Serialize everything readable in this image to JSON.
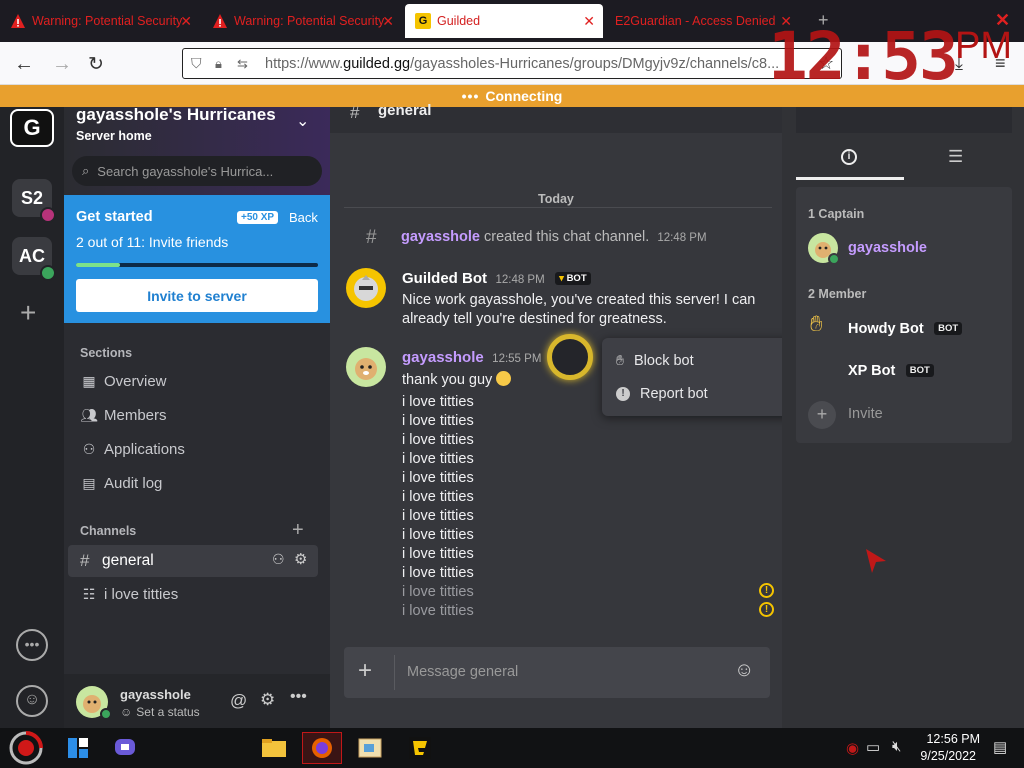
{
  "browser": {
    "tabs": [
      {
        "label": "Warning: Potential Security Risk",
        "active": false
      },
      {
        "label": "Warning: Potential Security Risk",
        "active": false
      },
      {
        "label": "Guilded",
        "active": true
      },
      {
        "label": "E2Guardian - Access Denied",
        "active": false
      }
    ],
    "url_prefix": "https://www.",
    "url_domain": "guilded.gg",
    "url_path": "/gayassholes-Hurricanes/groups/DMgyjv9z/channels/c8...",
    "overlay_time": "12:53",
    "overlay_ampm": "PM"
  },
  "connection_status": "Connecting",
  "server": {
    "name": "gayasshole's Hurricanes",
    "home_label": "Server home",
    "search_placeholder": "Search gayasshole's Hurrica...",
    "rail_icons": [
      "G",
      "S2",
      "AC"
    ]
  },
  "get_started": {
    "title": "Get started",
    "xp_badge": "+50 XP",
    "back_label": "Back",
    "progress_text": "2 out of 11: Invite friends",
    "progress_fraction": 0.18,
    "invite_button": "Invite to server"
  },
  "sections": {
    "header": "Sections",
    "items": [
      "Overview",
      "Members",
      "Applications",
      "Audit log"
    ]
  },
  "channels": {
    "header": "Channels",
    "items": [
      "general",
      "i love titties"
    ]
  },
  "user_panel": {
    "name": "gayasshole",
    "status": "Set a status"
  },
  "chat": {
    "channel_name": "general",
    "date_divider": "Today",
    "system_message": {
      "user": "gayasshole",
      "text": "created this chat channel.",
      "time": "12:48 PM"
    },
    "bot_message": {
      "author": "Guilded Bot",
      "time": "12:48 PM",
      "badge": "BOT",
      "line1": "Nice work gayasshole, you've created this server! I can",
      "line2": "already tell you're destined for greatness."
    },
    "user_message": {
      "author": "gayasshole",
      "time": "12:55 PM",
      "first_line": "thank you guy",
      "lines": [
        "i love titties",
        "i love titties",
        "i love titties",
        "i love titties",
        "i love titties",
        "i love titties",
        "i love titties",
        "i love titties",
        "i love titties",
        "i love titties",
        "i love titties",
        "i love titties"
      ]
    },
    "input_placeholder": "Message general"
  },
  "context_menu": {
    "items": [
      "Block bot",
      "Report bot"
    ]
  },
  "members": {
    "captain_header": "1 Captain",
    "captain_name": "gayasshole",
    "member_header": "2 Member",
    "members": [
      {
        "name": "Howdy Bot",
        "badge": "BOT"
      },
      {
        "name": "XP Bot",
        "badge": "BOT"
      }
    ],
    "invite_label": "Invite"
  },
  "taskbar": {
    "time": "12:56 PM",
    "date": "9/25/2022"
  },
  "colors": {
    "accent_blue": "#2891e0",
    "connecting_bar": "#e8a02e",
    "username_purple": "#c59cff",
    "warning_red": "#e02020"
  }
}
